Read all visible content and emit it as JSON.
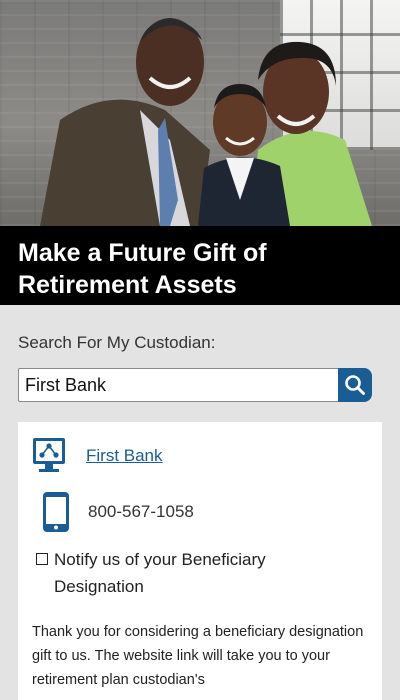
{
  "hero": {
    "image_description_icon": "family-photo",
    "title": "Make a Future Gift of Retirement Assets"
  },
  "search": {
    "label": "Search For My Custodian:",
    "value": "First Bank",
    "button_icon": "search-icon"
  },
  "result": {
    "custodian_icon": "computer-network-icon",
    "custodian_name": "First Bank",
    "phone_icon": "mobile-phone-icon",
    "phone": "800-567-1058",
    "notify_line1": "Notify us of your Beneficiary",
    "notify_line2": "Designation",
    "body": "Thank you for considering a beneficiary designation gift to us. The website link will take you to your retirement plan custodian's"
  },
  "colors": {
    "accent": "#1a5d94",
    "title_band": "#000000",
    "page_bg": "#e3e3e3"
  }
}
